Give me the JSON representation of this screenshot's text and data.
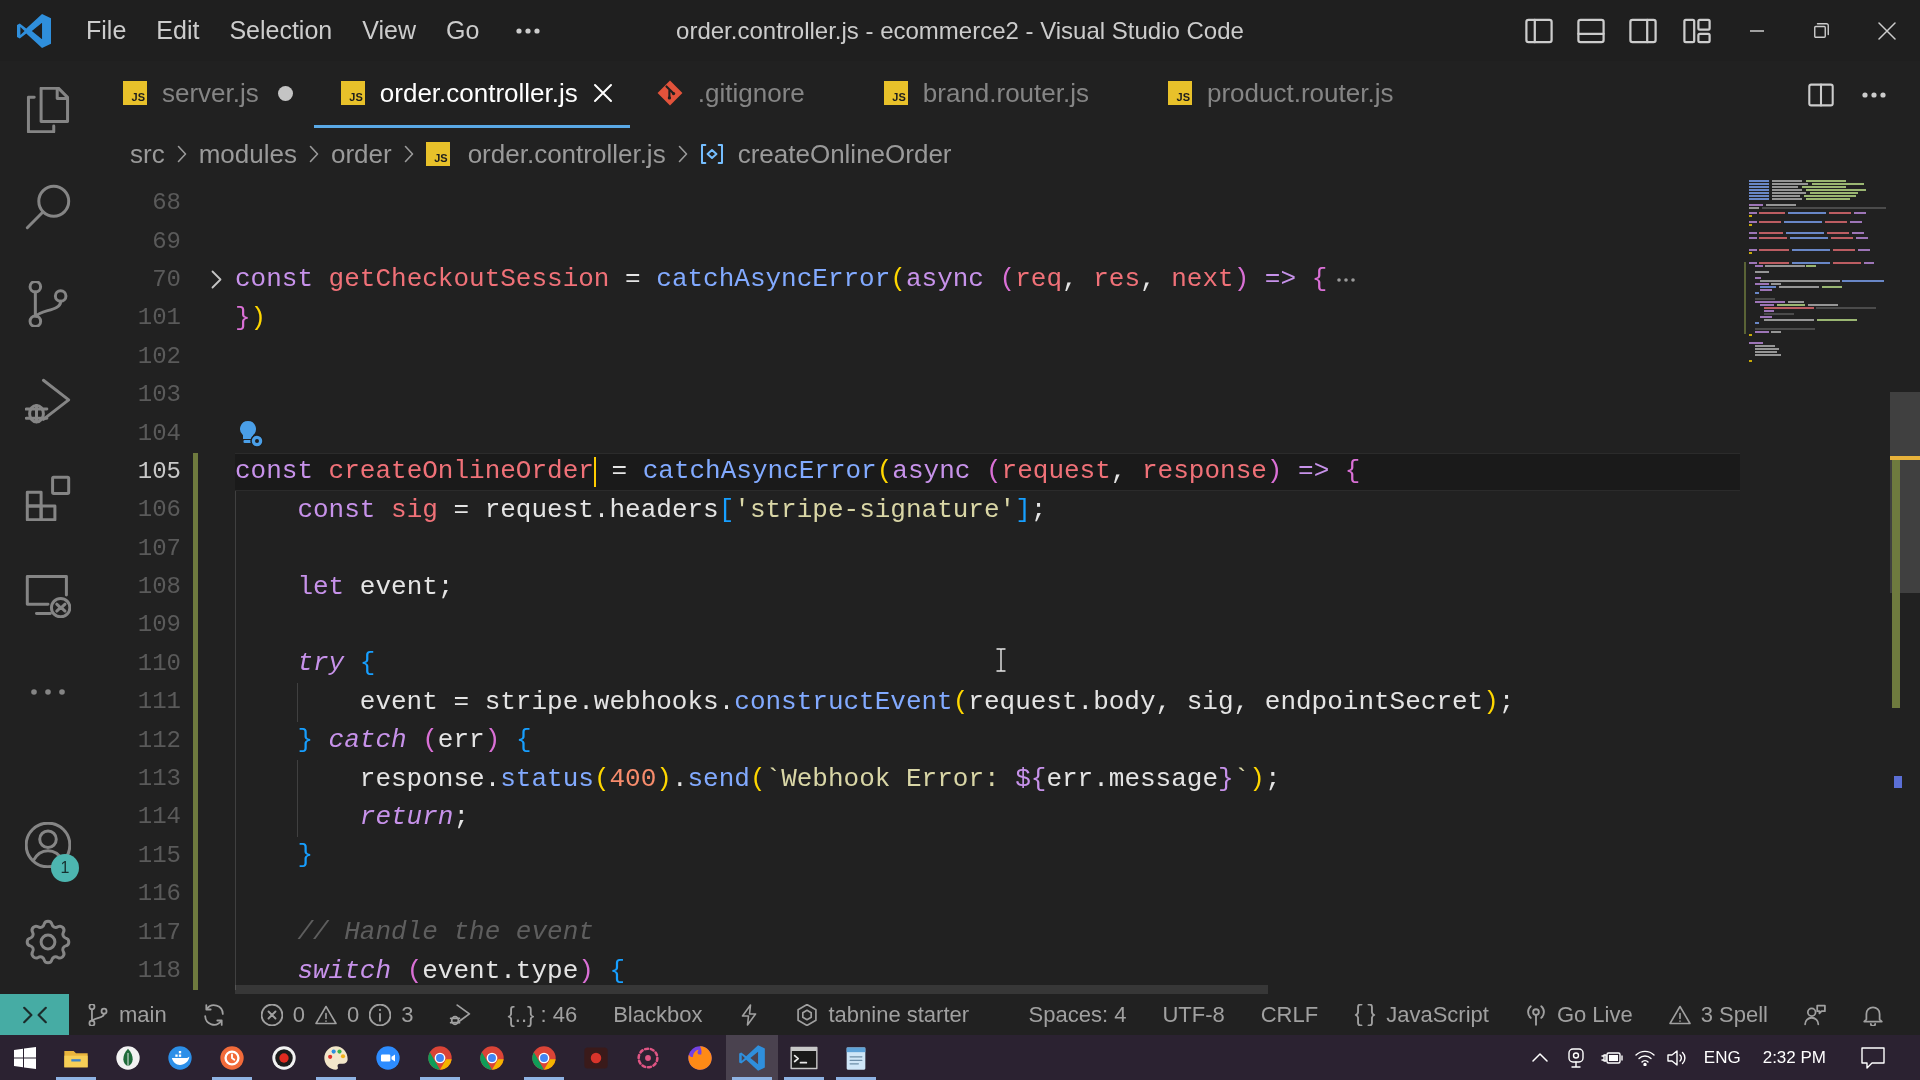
{
  "title_bar": {
    "menu": [
      "File",
      "Edit",
      "Selection",
      "View",
      "Go"
    ],
    "title": "order.controller.js - ecommerce2 - Visual Studio Code"
  },
  "activity_bar": {
    "accounts_badge": "1"
  },
  "tabs": [
    {
      "kind": "js",
      "badge": "JS",
      "label": "server.js",
      "selected": false,
      "modified": true
    },
    {
      "kind": "js",
      "badge": "JS",
      "label": "order.controller.js",
      "selected": true,
      "modified": false
    },
    {
      "kind": "git",
      "label": ".gitignore",
      "selected": false,
      "modified": false
    },
    {
      "kind": "js",
      "badge": "JS",
      "label": "brand.router.js",
      "selected": false,
      "modified": false
    },
    {
      "kind": "js",
      "badge": "JS",
      "label": "product.router.js",
      "selected": false,
      "modified": false
    }
  ],
  "breadcrumbs": [
    {
      "kind": "folder",
      "label": "src"
    },
    {
      "kind": "folder",
      "label": "modules"
    },
    {
      "kind": "folder",
      "label": "order"
    },
    {
      "kind": "js",
      "badge": "JS",
      "label": "order.controller.js"
    },
    {
      "kind": "symbol",
      "label": "createOnlineOrder"
    }
  ],
  "editor": {
    "lines": [
      {
        "number": "68",
        "changed": false,
        "current": false,
        "folded": false
      },
      {
        "number": "69",
        "changed": false,
        "current": false,
        "folded": false
      },
      {
        "number": "70",
        "changed": false,
        "current": false,
        "folded": true,
        "tokens": [
          {
            "kind": "keyword",
            "text": "const"
          },
          {
            "kind": "binding",
            "text": " getCheckoutSession"
          },
          {
            "kind": "plain",
            "text": " = "
          },
          {
            "kind": "function",
            "text": "catchAsyncError"
          },
          {
            "kind": "bracket1",
            "text": "("
          },
          {
            "kind": "keyword",
            "text": "async"
          },
          {
            "kind": "bracket2",
            "text": " ("
          },
          {
            "kind": "binding",
            "text": "req"
          },
          {
            "kind": "plain",
            "text": ", "
          },
          {
            "kind": "binding",
            "text": "res"
          },
          {
            "kind": "plain",
            "text": ", "
          },
          {
            "kind": "binding",
            "text": "next"
          },
          {
            "kind": "bracket2",
            "text": ")"
          },
          {
            "kind": "keyword",
            "text": " =>"
          },
          {
            "kind": "bracket2",
            "text": " {"
          },
          {
            "kind": "fold_ellipsis"
          }
        ]
      },
      {
        "number": "101",
        "changed": false,
        "current": false,
        "folded": false,
        "tokens": [
          {
            "kind": "bracket2",
            "text": "}"
          },
          {
            "kind": "bracket1",
            "text": ")"
          }
        ]
      },
      {
        "number": "102",
        "changed": false,
        "current": false,
        "folded": false
      },
      {
        "number": "103",
        "changed": false,
        "current": false,
        "folded": false
      },
      {
        "number": "104",
        "changed": false,
        "current": false,
        "folded": false,
        "tokens": [
          {
            "kind": "lightbulb"
          }
        ]
      },
      {
        "number": "105",
        "changed": true,
        "current": true,
        "folded": false,
        "tokens": [
          {
            "kind": "keyword",
            "text": "const"
          },
          {
            "kind": "binding",
            "text": " createOnlineOrder"
          },
          {
            "kind": "cursor"
          },
          {
            "kind": "plain",
            "text": " = "
          },
          {
            "kind": "function",
            "text": "catchAsyncError"
          },
          {
            "kind": "bracket1",
            "text": "("
          },
          {
            "kind": "keyword",
            "text": "async"
          },
          {
            "kind": "bracket2",
            "text": " ("
          },
          {
            "kind": "binding",
            "text": "request"
          },
          {
            "kind": "plain",
            "text": ", "
          },
          {
            "kind": "binding",
            "text": "response"
          },
          {
            "kind": "bracket2",
            "text": ")"
          },
          {
            "kind": "keyword",
            "text": " =>"
          },
          {
            "kind": "bracket2",
            "text": " {"
          }
        ],
        "children": [
          {
            "number": "106",
            "changed": true,
            "current": false,
            "folded": false,
            "tokens": [
              {
                "kind": "keyword",
                "text": "const"
              },
              {
                "kind": "binding",
                "text": " sig"
              },
              {
                "kind": "plain",
                "text": " = request.headers"
              },
              {
                "kind": "bracket3",
                "text": "["
              },
              {
                "kind": "string",
                "text": "'stripe-signature'"
              },
              {
                "kind": "bracket3",
                "text": "]"
              },
              {
                "kind": "plain",
                "text": ";"
              }
            ]
          },
          {
            "number": "107",
            "changed": true,
            "current": false,
            "folded": false
          },
          {
            "number": "108",
            "changed": true,
            "current": false,
            "folded": false,
            "tokens": [
              {
                "kind": "keyword",
                "text": "let"
              },
              {
                "kind": "plain",
                "text": " event;"
              }
            ]
          },
          {
            "number": "109",
            "changed": true,
            "current": false,
            "folded": false
          },
          {
            "number": "110",
            "changed": true,
            "current": false,
            "folded": false,
            "tokens": [
              {
                "kind": "control",
                "text": "try"
              },
              {
                "kind": "bracket3",
                "text": " {"
              }
            ],
            "children": [
              {
                "number": "111",
                "changed": true,
                "current": false,
                "folded": false,
                "tokens": [
                  {
                    "kind": "plain",
                    "text": "event = stripe.webhooks."
                  },
                  {
                    "kind": "function",
                    "text": "constructEvent"
                  },
                  {
                    "kind": "bracket1",
                    "text": "("
                  },
                  {
                    "kind": "plain",
                    "text": "request.body, sig, endpointSecret"
                  },
                  {
                    "kind": "bracket1",
                    "text": ")"
                  },
                  {
                    "kind": "plain",
                    "text": ";"
                  }
                ]
              }
            ]
          },
          {
            "number": "112",
            "changed": true,
            "current": false,
            "folded": false,
            "tokens": [
              {
                "kind": "bracket3",
                "text": "}"
              },
              {
                "kind": "control",
                "text": " catch"
              },
              {
                "kind": "bracket2",
                "text": " ("
              },
              {
                "kind": "plain",
                "text": "err"
              },
              {
                "kind": "bracket2",
                "text": ")"
              },
              {
                "kind": "bracket3",
                "text": " {"
              }
            ],
            "children": [
              {
                "number": "113",
                "changed": true,
                "current": false,
                "folded": false,
                "tokens": [
                  {
                    "kind": "plain",
                    "text": "response."
                  },
                  {
                    "kind": "function",
                    "text": "status"
                  },
                  {
                    "kind": "bracket1",
                    "text": "("
                  },
                  {
                    "kind": "number",
                    "text": "400"
                  },
                  {
                    "kind": "bracket1",
                    "text": ")"
                  },
                  {
                    "kind": "plain",
                    "text": "."
                  },
                  {
                    "kind": "function",
                    "text": "send"
                  },
                  {
                    "kind": "bracket1",
                    "text": "("
                  },
                  {
                    "kind": "string",
                    "text": "`Webhook Error: "
                  },
                  {
                    "kind": "keyword",
                    "text": "${"
                  },
                  {
                    "kind": "plain",
                    "text": "err.message"
                  },
                  {
                    "kind": "keyword",
                    "text": "}"
                  },
                  {
                    "kind": "string",
                    "text": "`"
                  },
                  {
                    "kind": "bracket1",
                    "text": ")"
                  },
                  {
                    "kind": "plain",
                    "text": ";"
                  }
                ]
              },
              {
                "number": "114",
                "changed": true,
                "current": false,
                "folded": false,
                "tokens": [
                  {
                    "kind": "control",
                    "text": "return"
                  },
                  {
                    "kind": "plain",
                    "text": ";"
                  }
                ]
              }
            ]
          },
          {
            "number": "115",
            "changed": true,
            "current": false,
            "folded": false,
            "tokens": [
              {
                "kind": "bracket3",
                "text": "}"
              }
            ]
          },
          {
            "number": "116",
            "changed": true,
            "current": false,
            "folded": false
          },
          {
            "number": "117",
            "changed": true,
            "current": false,
            "folded": false,
            "tokens": [
              {
                "kind": "comment",
                "text": "// Handle the event"
              }
            ]
          },
          {
            "number": "118",
            "changed": true,
            "current": false,
            "folded": false,
            "tokens": [
              {
                "kind": "control",
                "text": "switch"
              },
              {
                "kind": "bracket2",
                "text": " ("
              },
              {
                "kind": "plain",
                "text": "event.type"
              },
              {
                "kind": "bracket2",
                "text": ")"
              },
              {
                "kind": "bracket3",
                "text": " {"
              }
            ]
          }
        ]
      }
    ]
  },
  "status_bar": {
    "left": [
      {
        "kind": "remote"
      },
      {
        "kind": "branch",
        "text": "main"
      },
      {
        "kind": "sync"
      },
      {
        "kind": "problems",
        "counts": [
          {
            "kind": "error",
            "text": "0"
          },
          {
            "kind": "warning",
            "text": "0"
          },
          {
            "kind": "info",
            "text": "3"
          }
        ]
      },
      {
        "kind": "debug"
      },
      {
        "kind": "text",
        "text": "{..} : 46"
      },
      {
        "kind": "text",
        "text": "Blackbox"
      },
      {
        "kind": "bolt"
      },
      {
        "kind": "tabnine",
        "text": "tabnine starter"
      }
    ],
    "right": [
      {
        "kind": "text",
        "text": "Spaces: 4"
      },
      {
        "kind": "text",
        "text": "UTF-8"
      },
      {
        "kind": "text",
        "text": "CRLF"
      },
      {
        "kind": "language",
        "text": "JavaScript"
      },
      {
        "kind": "live",
        "text": "Go Live"
      },
      {
        "kind": "spell",
        "text": "3 Spell"
      },
      {
        "kind": "feedback"
      },
      {
        "kind": "bell"
      }
    ]
  },
  "taskbar": {
    "apps": [
      {
        "kind": "folder",
        "selected": false,
        "running": true
      },
      {
        "kind": "leaf",
        "selected": false,
        "running": false
      },
      {
        "kind": "whale",
        "selected": false,
        "running": false
      },
      {
        "kind": "clock",
        "selected": false,
        "running": true
      },
      {
        "kind": "record",
        "selected": false,
        "running": false
      },
      {
        "kind": "palette",
        "selected": false,
        "running": true
      },
      {
        "kind": "video",
        "selected": false,
        "running": false
      },
      {
        "kind": "browser",
        "selected": false,
        "running": true
      },
      {
        "kind": "browser",
        "selected": false,
        "running": false
      },
      {
        "kind": "browser",
        "selected": false,
        "running": true
      },
      {
        "kind": "camera",
        "selected": false,
        "running": false
      },
      {
        "kind": "flower",
        "selected": false,
        "running": false
      },
      {
        "kind": "fox",
        "selected": false,
        "running": false
      },
      {
        "kind": "editor",
        "selected": true,
        "running": true
      },
      {
        "kind": "terminal",
        "selected": false,
        "running": true
      },
      {
        "kind": "notepad",
        "selected": false,
        "running": true
      }
    ],
    "language": "ENG",
    "time": "2:32 PM"
  }
}
